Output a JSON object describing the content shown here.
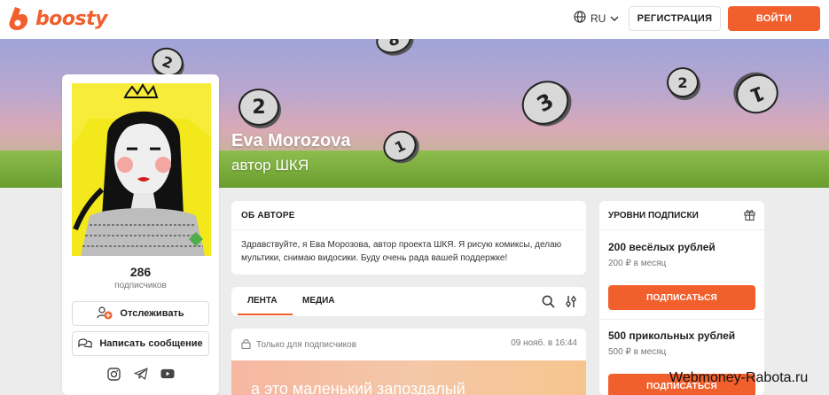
{
  "header": {
    "logo_text": "boosty",
    "language": "RU",
    "register_label": "РЕГИСТРАЦИЯ",
    "login_label": "ВОЙТИ",
    "accent_color": "#f15f2c"
  },
  "banner": {
    "name": "Eva Morozova",
    "subtitle": "автор ШКЯ",
    "coins": [
      "8",
      "2",
      "2",
      "3",
      "2",
      "1",
      "1"
    ]
  },
  "profile": {
    "subscriber_count": "286",
    "subscriber_label": "подписчиков",
    "follow_label": "Отслеживать",
    "message_label": "Написать сообщение",
    "social_icons": [
      "instagram-icon",
      "telegram-icon",
      "youtube-icon"
    ]
  },
  "about": {
    "heading": "ОБ АВТОРЕ",
    "text": "Здравствуйте, я Ева Морозова, автор проекта ШКЯ. Я рисую комиксы, делаю мультики, снимаю видосики. Буду очень рада вашей поддержке!"
  },
  "feed_tabs": {
    "tabs": [
      "ЛЕНТА",
      "МЕДИА"
    ],
    "active": "ЛЕНТА"
  },
  "post": {
    "access_label": "Только для подписчиков",
    "date": "09 нояб. в 16:44",
    "preview_text": "а это маленький запоздалый"
  },
  "tiers": {
    "heading": "УРОВНИ ПОДПИСКИ",
    "items": [
      {
        "title": "200 весёлых рублей",
        "price": "200 ₽ в месяц",
        "button": "ПОДПИСАТЬСЯ"
      },
      {
        "title": "500 прикольных рублей",
        "price": "500 ₽ в месяц",
        "button": "ПОДПИСАТЬСЯ"
      }
    ]
  },
  "watermark": "Webmoney-Rabota.ru"
}
